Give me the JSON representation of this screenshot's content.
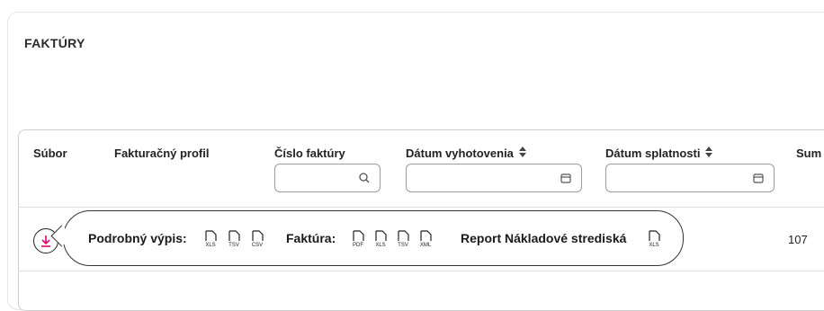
{
  "section": {
    "title": "FAKTÚRY"
  },
  "table": {
    "columns": [
      {
        "label": "Súbor",
        "sortable": false
      },
      {
        "label": "Fakturačný profil",
        "sortable": false
      },
      {
        "label": "Číslo faktúry",
        "sortable": false
      },
      {
        "label": "Dátum vyhotovenia",
        "sortable": true
      },
      {
        "label": "Dátum splatnosti",
        "sortable": true
      },
      {
        "label": "Sum",
        "sortable": false
      }
    ],
    "filters": {
      "invoice_number": {
        "value": "",
        "placeholder": "",
        "icon": "search-icon"
      },
      "issue_date": {
        "value": "",
        "placeholder": "",
        "icon": "calendar-icon"
      },
      "due_date": {
        "value": "",
        "placeholder": "",
        "icon": "calendar-icon"
      }
    },
    "rows": [
      {
        "sum": "107"
      }
    ]
  },
  "download_popover": {
    "detailed_label": "Podrobný výpis:",
    "detailed_formats": [
      "XLS",
      "TSV",
      "CSV"
    ],
    "invoice_label": "Faktúra:",
    "invoice_formats": [
      "PDF",
      "XLS",
      "TSV",
      "XML"
    ],
    "report_label": "Report Nákladové strediská",
    "report_formats": [
      "XLS"
    ]
  },
  "colors": {
    "accent": "#e20074",
    "border": "#cfcfcf",
    "text": "#1a1a1a"
  }
}
